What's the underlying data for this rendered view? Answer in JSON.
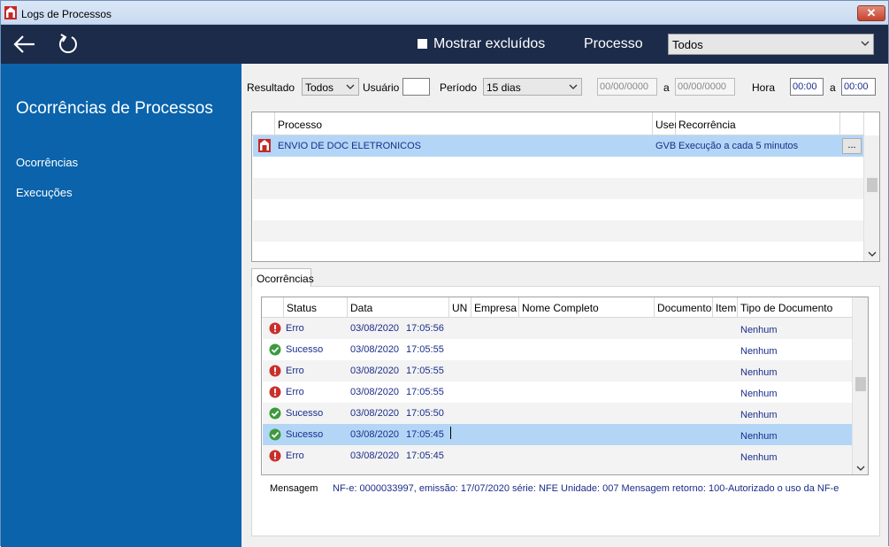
{
  "window": {
    "title": "Logs de Processos",
    "close_glyph": "✕"
  },
  "toolbar": {
    "show_deleted_label": "Mostrar excluídos",
    "process_label": "Processo",
    "process_value": "Todos"
  },
  "sidebar": {
    "title": "Ocorrências de Processos",
    "items": [
      "Ocorrências",
      "Execuções"
    ]
  },
  "filters": {
    "resultado_label": "Resultado",
    "resultado_value": "Todos",
    "usuario_label": "Usuário",
    "usuario_value": "",
    "periodo_label": "Período",
    "periodo_value": "15 dias",
    "date_from": "00/00/0000",
    "date_sep": "a",
    "date_to": "00/00/0000",
    "hora_label": "Hora",
    "hora_from": "00:00",
    "hora_sep": "a",
    "hora_to": "00:00"
  },
  "process_grid": {
    "columns": [
      "Processo",
      "User",
      "Recorrência"
    ],
    "rows": [
      {
        "process": "ENVIO DE DOC ELETRONICOS",
        "user": "GVB",
        "recurrence": "Execução a cada 5 minutos",
        "button": "..."
      }
    ]
  },
  "tabs": {
    "active": "Ocorrências"
  },
  "occurrences_grid": {
    "columns": [
      "Status",
      "Data",
      "UN",
      "Empresa",
      "Nome Completo",
      "Documento",
      "Item",
      "Tipo de Documento"
    ],
    "rows": [
      {
        "status": "Erro",
        "kind": "error",
        "date": "03/08/2020",
        "time": "17:05:56",
        "doc_type": "Nenhum"
      },
      {
        "status": "Sucesso",
        "kind": "success",
        "date": "03/08/2020",
        "time": "17:05:55",
        "doc_type": "Nenhum"
      },
      {
        "status": "Erro",
        "kind": "error",
        "date": "03/08/2020",
        "time": "17:05:55",
        "doc_type": "Nenhum"
      },
      {
        "status": "Erro",
        "kind": "error",
        "date": "03/08/2020",
        "time": "17:05:55",
        "doc_type": "Nenhum"
      },
      {
        "status": "Sucesso",
        "kind": "success",
        "date": "03/08/2020",
        "time": "17:05:50",
        "doc_type": "Nenhum"
      },
      {
        "status": "Sucesso",
        "kind": "success",
        "date": "03/08/2020",
        "time": "17:05:45",
        "doc_type": "Nenhum"
      },
      {
        "status": "Erro",
        "kind": "error",
        "date": "03/08/2020",
        "time": "17:05:45",
        "doc_type": "Nenhum"
      }
    ]
  },
  "message": {
    "label": "Mensagem",
    "value": "NF-e: 0000033997, emissão: 17/07/2020 série: NFE Unidade: 007 Mensagem retorno: 100-Autorizado o uso da NF-e"
  },
  "colors": {
    "sidebar": "#0a63ab",
    "toolbar": "#1c2b4a",
    "selected_row": "#b3d6f7",
    "error": "#c9302c",
    "success": "#3c9a3c"
  },
  "icons": [
    "app-logo-icon",
    "back-arrow-icon",
    "refresh-icon",
    "chevron-down-icon",
    "error-icon",
    "success-icon",
    "process-icon"
  ]
}
